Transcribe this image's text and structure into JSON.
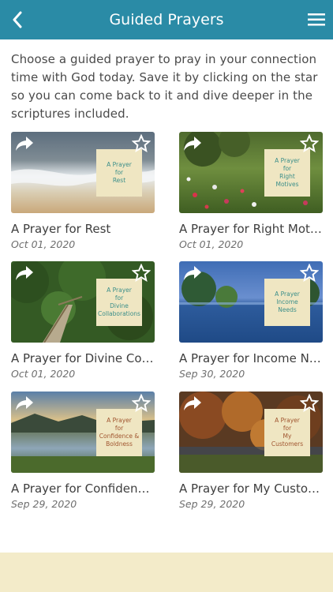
{
  "header": {
    "title": "Guided Prayers",
    "back_icon": "chevron-left-icon",
    "menu_icon": "hamburger-menu-icon",
    "color": "#2a8ba6"
  },
  "intro": "Choose a guided prayer to pray in your connection time with God today. Save it by clicking on the star so you can come back to it and dive deeper in the scriptures included.",
  "prayers": [
    {
      "title": "A Prayer for Rest",
      "date": "Oct 01, 2020",
      "plate": [
        "A Prayer",
        "for",
        "Rest"
      ],
      "plate_color": "#3c8f8a"
    },
    {
      "title": "A Prayer for Right Motives",
      "date": "Oct 01, 2020",
      "plate": [
        "A Prayer",
        "for",
        "Right",
        "Motives"
      ],
      "plate_color": "#3c8f8a"
    },
    {
      "title": "A Prayer for Divine Collaborations",
      "date": "Oct 01, 2020",
      "plate": [
        "A Prayer",
        "for",
        "Divine",
        "Collaborations"
      ],
      "plate_color": "#3c8f8a"
    },
    {
      "title": "A Prayer for Income Needs",
      "date": "Sep 30, 2020",
      "plate": [
        "A Prayer",
        "Income",
        "Needs"
      ],
      "plate_color": "#3c8f8a"
    },
    {
      "title": "A Prayer for Confidence & Boldness",
      "date": "Sep 29, 2020",
      "plate": [
        "A Prayer",
        "for",
        "Confidence &",
        "Boldness"
      ],
      "plate_color": "#a0552f"
    },
    {
      "title": "A Prayer for My Customers",
      "date": "Sep 29, 2020",
      "plate": [
        "A Prayer",
        "for",
        "My",
        "Customers"
      ],
      "plate_color": "#a0552f"
    }
  ]
}
